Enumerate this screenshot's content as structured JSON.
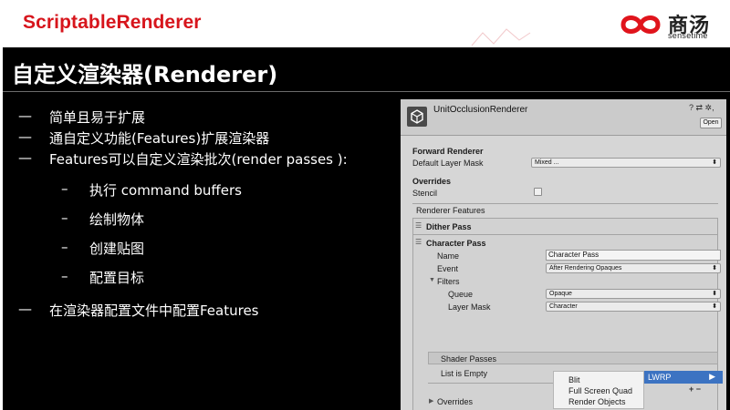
{
  "header": {
    "title": "ScriptableRenderer",
    "logo_cn": "商汤",
    "logo_en": "sensetime",
    "brand_color": "#d7151c"
  },
  "slide": {
    "heading": "自定义渲染器(Renderer)",
    "bullets": [
      {
        "dash": "—",
        "text": "简单且易于扩展"
      },
      {
        "dash": "—",
        "text": "通自定义功能(Features)扩展渲染器"
      },
      {
        "dash": "—",
        "text": "Features可以自定义渲染批次(render passes ):"
      }
    ],
    "sub_bullets": [
      {
        "dash": "–",
        "text": "执行 command buffers"
      },
      {
        "dash": "–",
        "text": "绘制物体"
      },
      {
        "dash": "–",
        "text": "创建贴图"
      },
      {
        "dash": "–",
        "text": "配置目标"
      }
    ],
    "last_bullet": {
      "dash": "—",
      "text": "在渲染器配置文件中配置Features"
    }
  },
  "inspector": {
    "title": "UnitOcclusionRenderer",
    "header_icons": "? ⇄ ✲,",
    "open_label": "Open",
    "forward_renderer": "Forward Renderer",
    "default_layer_mask_label": "Default Layer Mask",
    "default_layer_mask_value": "Mixed ...",
    "overrides_label": "Overrides",
    "stencil_label": "Stencil",
    "renderer_features_label": "Renderer Features",
    "dither_pass": "Dither Pass",
    "character_pass": "Character Pass",
    "name_label": "Name",
    "name_value": "Character Pass",
    "event_label": "Event",
    "event_value": "After Rendering Opaques",
    "filters_label": "Filters",
    "queue_label": "Queue",
    "queue_value": "Opaque",
    "layer_mask_label": "Layer Mask",
    "layer_mask_value": "Character",
    "shader_passes_label": "Shader Passes",
    "list_empty_label": "List is Empty",
    "overrides_fold_label": "Overrides",
    "plus_minus": "+ −",
    "plus_minus_2": "+ —"
  },
  "context_menu": {
    "items": [
      "Blit",
      "Full Screen Quad",
      "Render Objects"
    ],
    "submenu_label": "LWRP",
    "submenu_arrow": "▶",
    "highlight_color": "#3c73c2"
  }
}
